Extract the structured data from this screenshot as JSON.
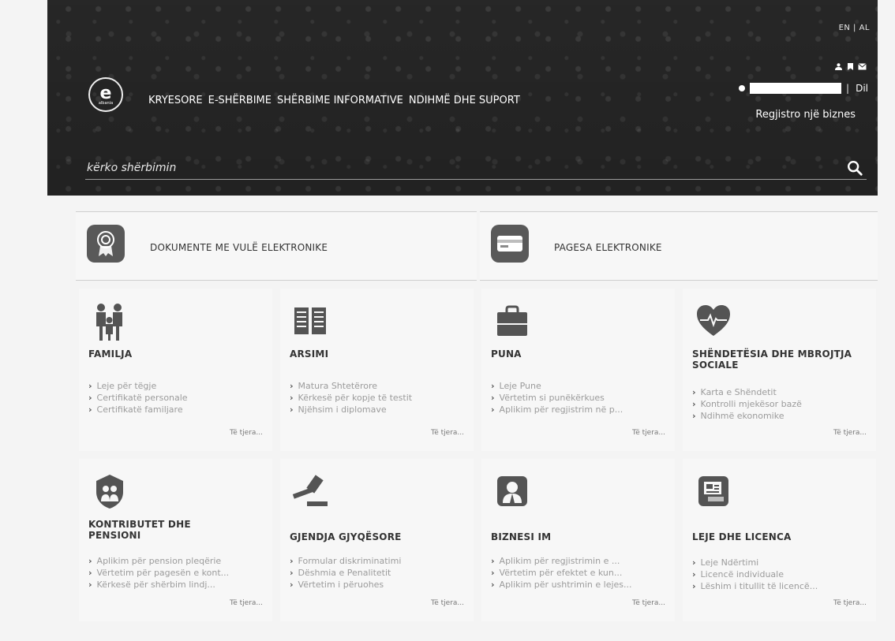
{
  "header": {
    "lang": "EN | AL",
    "logo": {
      "letter": "e",
      "small": "albania"
    },
    "nav": [
      "KRYESORE",
      "E-SHËRBIME",
      "SHËRBIME INFORMATIVE",
      "NDIHMË DHE SUPORT"
    ],
    "logout": "Dil",
    "register": "Regjistro një biznes",
    "search_placeholder": "kërko shërbimin",
    "icons": [
      "user-icon",
      "bookmark-icon",
      "mail-icon",
      "search-icon"
    ]
  },
  "quick": [
    {
      "label": "DOKUMENTE ME VULË ELEKTRONIKE",
      "icon": "seal-icon"
    },
    {
      "label": "PAGESA ELEKTRONIKE",
      "icon": "card-icon"
    }
  ],
  "categories": [
    {
      "title": "FAMILJA",
      "icon": "family-icon",
      "links": [
        "Leje për tëgje",
        "Certifikatë personale",
        "Certifikatë familjare"
      ],
      "more": "Të tjera..."
    },
    {
      "title": "ARSIMI",
      "icon": "book-icon",
      "links": [
        "Matura Shtetërore",
        "Kërkesë për kopje të testit",
        "Njëhsim i diplomave"
      ],
      "more": "Të tjera..."
    },
    {
      "title": "PUNA",
      "icon": "briefcase-icon",
      "links": [
        "Leje Pune",
        "Vërtetim si punëkërkues",
        "Aplikim për regjistrim në p..."
      ],
      "more": "Të tjera..."
    },
    {
      "title": "SHËNDETËSIA DHE MBROJTJA SOCIALE",
      "icon": "heart-icon",
      "links": [
        "Karta e Shëndetit",
        "Kontrolli mjekësor bazë",
        "Ndihmë ekonomike"
      ],
      "more": "Të tjera..."
    },
    {
      "title": "KONTRIBUTET DHE PENSIONI",
      "icon": "shield-family-icon",
      "links": [
        "Aplikim për pension pleqërie",
        "Vërtetim për pagesën e kont...",
        "Kërkesë për shërbim lindj..."
      ],
      "more": "Të tjera..."
    },
    {
      "title": "GJENDJA GJYQËSORE",
      "icon": "gavel-icon",
      "links": [
        "Formular diskriminatimi",
        "Dëshmia e Penalitetit",
        "Vërtetim i përuohes"
      ],
      "more": "Të tjera..."
    },
    {
      "title": "BIZNESI IM",
      "icon": "business-person-icon",
      "links": [
        "Aplikim për regjistrimin e ...",
        "Vërtetim për efektet e kun...",
        "Aplikim për ushtrimin e lejes..."
      ],
      "more": "Të tjera..."
    },
    {
      "title": "LEJE DHE LICENCA",
      "icon": "documents-icon",
      "links": [
        "Leje Ndërtimi",
        "Licencë individuale",
        "Lëshim i titullit të licencë..."
      ],
      "more": "Të tjera..."
    }
  ],
  "colors": {
    "header_bg": "#2b2b2b",
    "icon_dark": "#545454",
    "card_bg": "#f7f7f7"
  }
}
